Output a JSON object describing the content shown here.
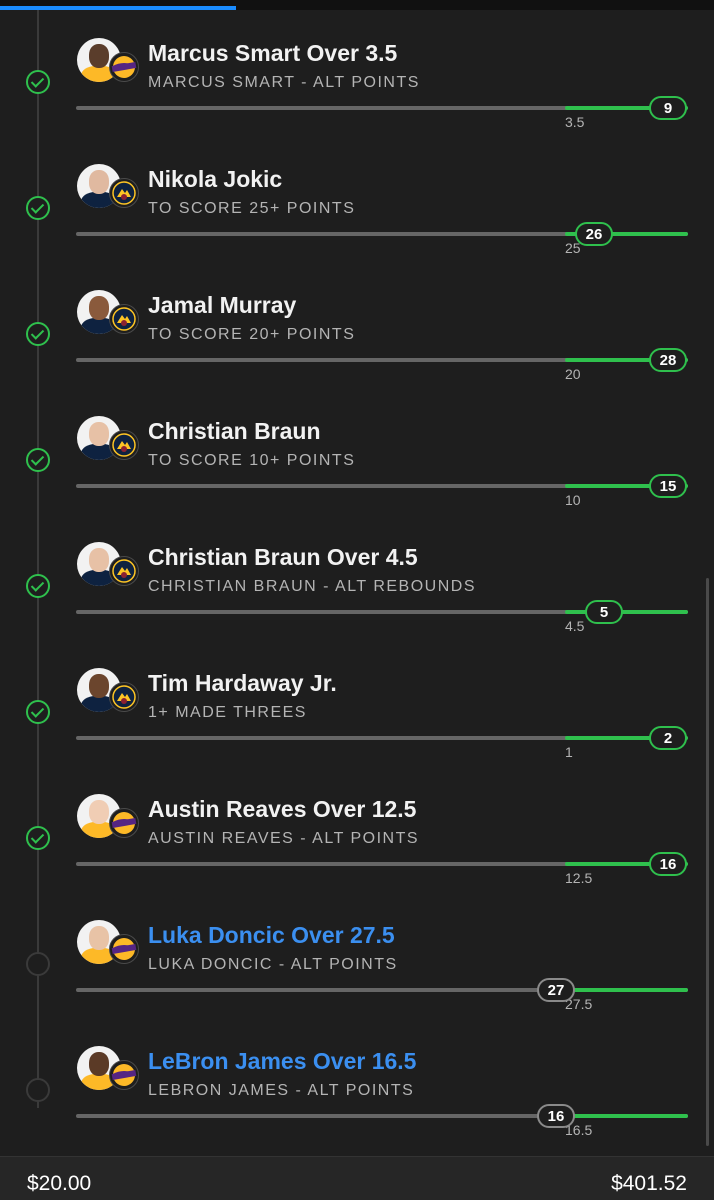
{
  "colors": {
    "accent": "#1a8cff",
    "won": "#2fc04d",
    "pending_title": "#3b8ff0"
  },
  "header": {
    "scroll_progress": 0.33
  },
  "legs": [
    {
      "title": "Marcus Smart Over 3.5",
      "subtitle": "MARCUS SMART - ALT POINTS",
      "target": 3.5,
      "target_label": "3.5",
      "value": 9,
      "value_label": "9",
      "status": "won",
      "team": "lakers",
      "jersey": "#fdb927",
      "skin": "#5a3d2b"
    },
    {
      "title": "Nikola Jokic",
      "subtitle": "TO SCORE 25+ POINTS",
      "target": 25,
      "target_label": "25",
      "value": 26,
      "value_label": "26",
      "status": "won",
      "team": "nuggets",
      "jersey": "#0e2240",
      "skin": "#e0b9a0"
    },
    {
      "title": "Jamal Murray",
      "subtitle": "TO SCORE 20+ POINTS",
      "target": 20,
      "target_label": "20",
      "value": 28,
      "value_label": "28",
      "status": "won",
      "team": "nuggets",
      "jersey": "#0e2240",
      "skin": "#8a5a3c"
    },
    {
      "title": "Christian Braun",
      "subtitle": "TO SCORE 10+ POINTS",
      "target": 10,
      "target_label": "10",
      "value": 15,
      "value_label": "15",
      "status": "won",
      "team": "nuggets",
      "jersey": "#0e2240",
      "skin": "#e7c1a6"
    },
    {
      "title": "Christian Braun Over 4.5",
      "subtitle": "CHRISTIAN BRAUN - ALT REBOUNDS",
      "target": 4.5,
      "target_label": "4.5",
      "value": 5,
      "value_label": "5",
      "status": "won",
      "team": "nuggets",
      "jersey": "#0e2240",
      "skin": "#e7c1a6"
    },
    {
      "title": "Tim Hardaway Jr.",
      "subtitle": "1+ MADE THREES",
      "target": 1,
      "target_label": "1",
      "value": 2,
      "value_label": "2",
      "status": "won",
      "team": "nuggets",
      "jersey": "#0e2240",
      "skin": "#6b452d"
    },
    {
      "title": "Austin Reaves Over 12.5",
      "subtitle": "AUSTIN REAVES - ALT POINTS",
      "target": 12.5,
      "target_label": "12.5",
      "value": 16,
      "value_label": "16",
      "status": "won",
      "team": "lakers",
      "jersey": "#fdb927",
      "skin": "#f0cdb4"
    },
    {
      "title": "Luka Doncic Over 27.5",
      "subtitle": "LUKA DONCIC - ALT POINTS",
      "target": 27.5,
      "target_label": "27.5",
      "value": 27,
      "value_label": "27",
      "status": "pending",
      "team": "lakers",
      "jersey": "#fdb927",
      "skin": "#e8c3a6"
    },
    {
      "title": "LeBron James Over 16.5",
      "subtitle": "LEBRON JAMES - ALT POINTS",
      "target": 16.5,
      "target_label": "16.5",
      "value": 16,
      "value_label": "16",
      "status": "pending",
      "team": "lakers",
      "jersey": "#fdb927",
      "skin": "#5b3a26"
    }
  ],
  "footer": {
    "wager": "$20.00",
    "payout": "$401.52"
  }
}
